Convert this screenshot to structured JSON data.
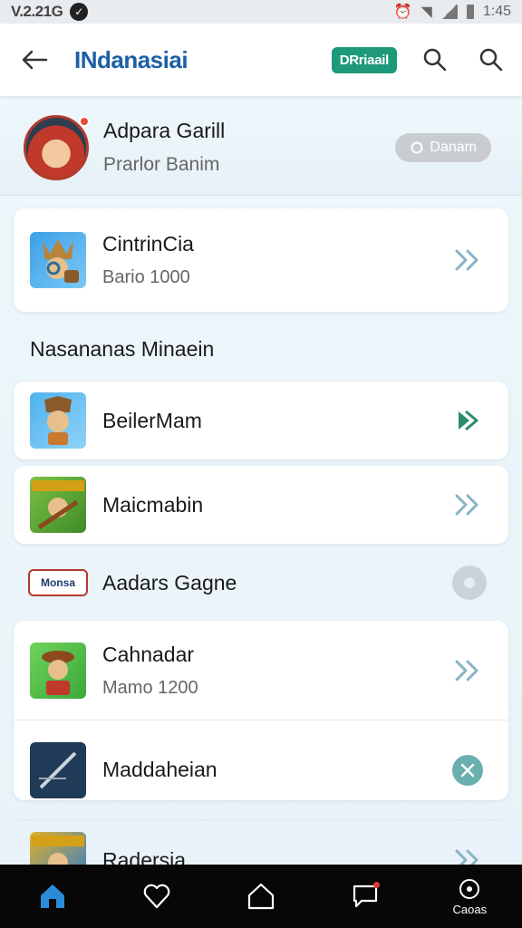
{
  "status_bar": {
    "time_left": "V.2.21G",
    "time_right": "1:45"
  },
  "app_bar": {
    "title": "INdanasiai",
    "badge": "DRriaail"
  },
  "profile": {
    "name": "Adpara Garill",
    "subtitle": "Prarlor Banim",
    "button_label": "Danam"
  },
  "featured": {
    "title": "CintrinCia",
    "subtitle": "Bario 1000"
  },
  "section": {
    "title": "Nasananas Minaein"
  },
  "items": [
    {
      "title": "BeilerMam"
    },
    {
      "title": "Maicmabin"
    }
  ],
  "plain_row": {
    "logo_text": "Monsa",
    "label": "Aadars Gagne"
  },
  "list": [
    {
      "title": "Cahnadar",
      "subtitle": "Mamo 1200"
    },
    {
      "title": "Maddaheian"
    },
    {
      "title": "Radersia"
    }
  ],
  "bottom_nav": {
    "last_label": "Caoas"
  },
  "colors": {
    "accent": "#1d5fa4",
    "badge": "#1e9a7a",
    "chevron": "#8ab3c6",
    "chevron_active": "#2e8b6e"
  }
}
